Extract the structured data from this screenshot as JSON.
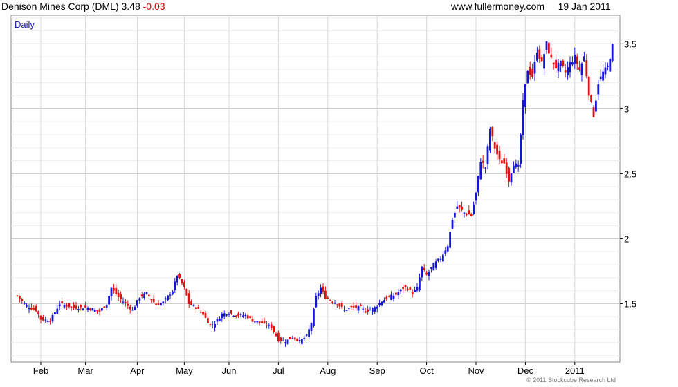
{
  "header": {
    "security": "Denison Mines Corp (DML)",
    "last_price": "3.48",
    "change": "-0.03",
    "site": "www.fullermoney.com",
    "date": "19 Jan 2011"
  },
  "period_label": "Daily",
  "copyright": "© 2011 Stockcube Research Ltd",
  "colors": {
    "up": "#1515d8",
    "down": "#e01010",
    "grid": "#d8d8d8",
    "grid_minor": "#eeeeee"
  },
  "chart_data": {
    "type": "candlestick",
    "title": "Denison Mines Corp (DML)",
    "ylim": [
      1.05,
      3.72
    ],
    "y_ticks": [
      {
        "value": 1.5,
        "label": "1.5"
      },
      {
        "value": 2,
        "label": "2"
      },
      {
        "value": 2.5,
        "label": "2.5"
      },
      {
        "value": 3,
        "label": "3"
      },
      {
        "value": 3.5,
        "label": "3.5"
      }
    ],
    "x_ticks": [
      {
        "index": 10,
        "label": "Feb"
      },
      {
        "index": 29,
        "label": "Mar"
      },
      {
        "index": 51,
        "label": "Apr"
      },
      {
        "index": 71,
        "label": "May"
      },
      {
        "index": 90,
        "label": "Jun"
      },
      {
        "index": 111,
        "label": "Jul"
      },
      {
        "index": 132,
        "label": "Aug"
      },
      {
        "index": 153,
        "label": "Sep"
      },
      {
        "index": 174,
        "label": "Oct"
      },
      {
        "index": 195,
        "label": "Nov"
      },
      {
        "index": 216,
        "label": "Dec"
      },
      {
        "index": 237,
        "label": "2011"
      }
    ],
    "close_points": [
      [
        0,
        1.56
      ],
      [
        4,
        1.48
      ],
      [
        8,
        1.45
      ],
      [
        10,
        1.38
      ],
      [
        14,
        1.37
      ],
      [
        18,
        1.5
      ],
      [
        24,
        1.47
      ],
      [
        30,
        1.47
      ],
      [
        35,
        1.44
      ],
      [
        38,
        1.5
      ],
      [
        40,
        1.62
      ],
      [
        43,
        1.55
      ],
      [
        46,
        1.5
      ],
      [
        49,
        1.45
      ],
      [
        52,
        1.55
      ],
      [
        55,
        1.58
      ],
      [
        59,
        1.49
      ],
      [
        62,
        1.51
      ],
      [
        66,
        1.6
      ],
      [
        68,
        1.72
      ],
      [
        71,
        1.62
      ],
      [
        73,
        1.5
      ],
      [
        76,
        1.47
      ],
      [
        79,
        1.42
      ],
      [
        82,
        1.33
      ],
      [
        84,
        1.35
      ],
      [
        87,
        1.42
      ],
      [
        90,
        1.43
      ],
      [
        93,
        1.41
      ],
      [
        97,
        1.41
      ],
      [
        100,
        1.37
      ],
      [
        104,
        1.35
      ],
      [
        108,
        1.32
      ],
      [
        111,
        1.22
      ],
      [
        114,
        1.21
      ],
      [
        117,
        1.24
      ],
      [
        120,
        1.21
      ],
      [
        123,
        1.25
      ],
      [
        125,
        1.35
      ],
      [
        127,
        1.55
      ],
      [
        129,
        1.62
      ],
      [
        131,
        1.55
      ],
      [
        133,
        1.53
      ],
      [
        136,
        1.5
      ],
      [
        139,
        1.45
      ],
      [
        142,
        1.47
      ],
      [
        146,
        1.47
      ],
      [
        148,
        1.44
      ],
      [
        152,
        1.47
      ],
      [
        155,
        1.52
      ],
      [
        158,
        1.55
      ],
      [
        161,
        1.57
      ],
      [
        164,
        1.62
      ],
      [
        166,
        1.62
      ],
      [
        168,
        1.58
      ],
      [
        170,
        1.62
      ],
      [
        172,
        1.78
      ],
      [
        174,
        1.72
      ],
      [
        177,
        1.8
      ],
      [
        180,
        1.85
      ],
      [
        183,
        1.95
      ],
      [
        185,
        2.15
      ],
      [
        187,
        2.25
      ],
      [
        190,
        2.2
      ],
      [
        193,
        2.18
      ],
      [
        195,
        2.35
      ],
      [
        197,
        2.6
      ],
      [
        199,
        2.55
      ],
      [
        201,
        2.85
      ],
      [
        203,
        2.7
      ],
      [
        205,
        2.6
      ],
      [
        207,
        2.58
      ],
      [
        209,
        2.45
      ],
      [
        211,
        2.58
      ],
      [
        213,
        2.55
      ],
      [
        215,
        3.05
      ],
      [
        217,
        3.3
      ],
      [
        219,
        3.25
      ],
      [
        221,
        3.45
      ],
      [
        223,
        3.35
      ],
      [
        225,
        3.5
      ],
      [
        227,
        3.38
      ],
      [
        229,
        3.32
      ],
      [
        231,
        3.35
      ],
      [
        233,
        3.28
      ],
      [
        235,
        3.35
      ],
      [
        237,
        3.4
      ],
      [
        239,
        3.3
      ],
      [
        241,
        3.4
      ],
      [
        243,
        3.12
      ],
      [
        245,
        2.95
      ],
      [
        247,
        3.2
      ],
      [
        249,
        3.28
      ],
      [
        251,
        3.32
      ],
      [
        253,
        3.48
      ]
    ]
  }
}
